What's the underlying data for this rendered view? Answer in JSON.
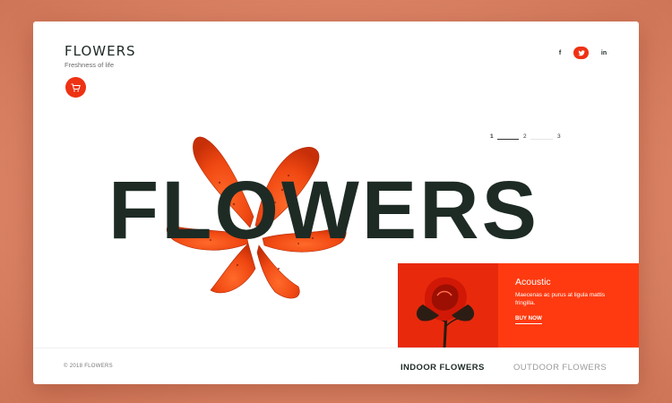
{
  "brand": {
    "title": "FLOWERS",
    "tagline": "Freshness of life"
  },
  "header": {
    "cart_icon": "cart-icon",
    "social": [
      {
        "label": "f",
        "icon": "facebook-icon"
      },
      {
        "label": "t",
        "icon": "twitter-icon"
      },
      {
        "label": "in",
        "icon": "linkedin-icon"
      }
    ]
  },
  "pager": {
    "pages": [
      "1",
      "2",
      "3"
    ],
    "active": "1"
  },
  "hero": {
    "word": "FLOWERS"
  },
  "promo": {
    "title": "Acoustic",
    "description": "Maecenas ac purus at ligula mattis fringilla.",
    "cta": "BUY NOW"
  },
  "footer": {
    "copyright": "© 2018 FLOWERS",
    "tabs": [
      {
        "label": "INDOOR FLOWERS",
        "active": true
      },
      {
        "label": "OUTDOOR FLOWERS",
        "active": false
      }
    ]
  },
  "colors": {
    "accent": "#ee3214",
    "promo_bg": "#ff3a10",
    "text_dark": "#1d2b24",
    "page_bg": "#dc8466"
  }
}
